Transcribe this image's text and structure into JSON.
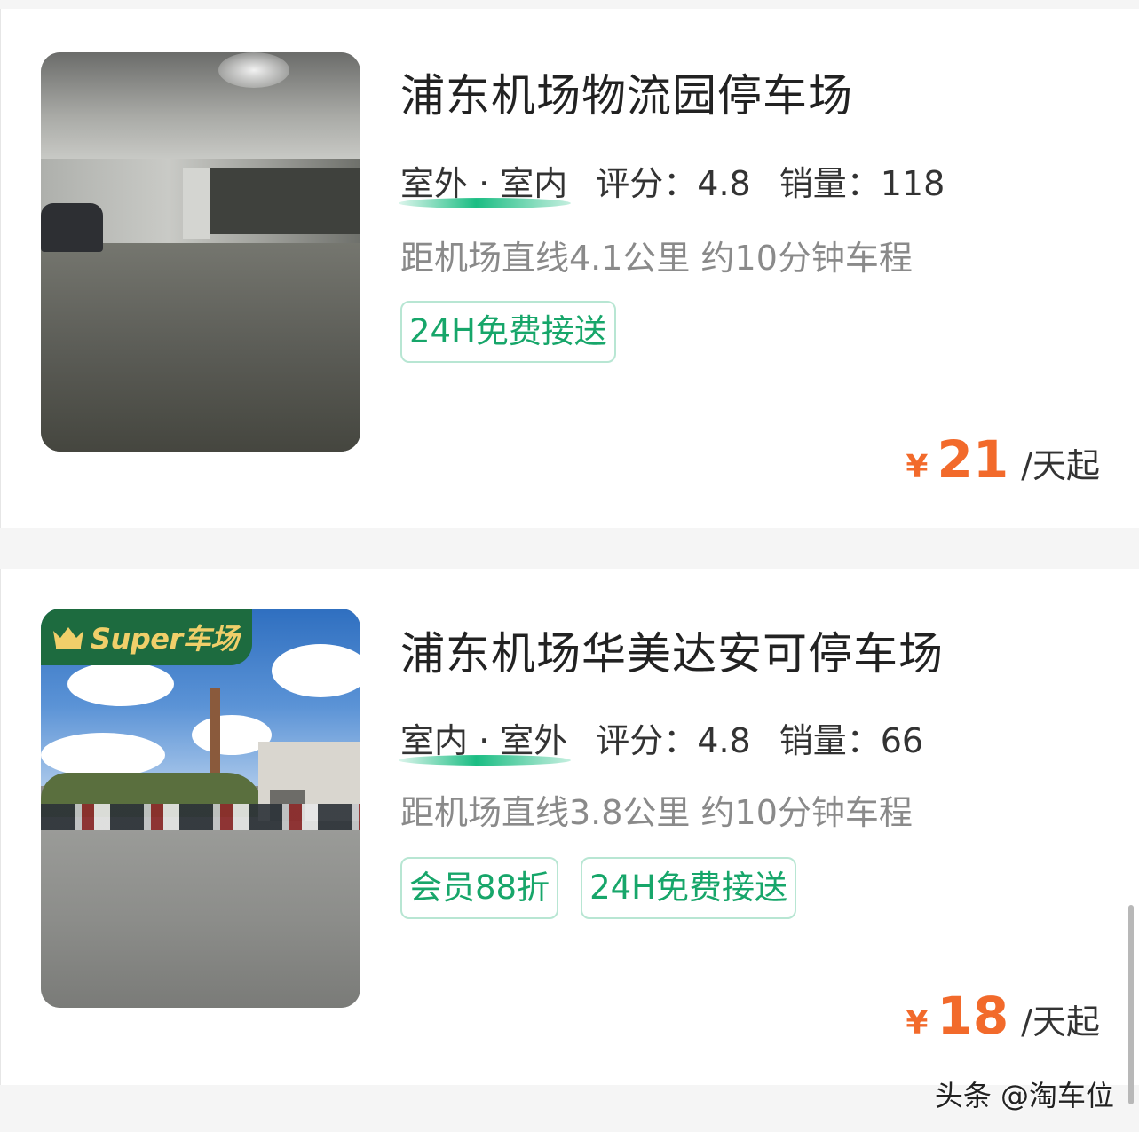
{
  "listings": [
    {
      "title": "浦东机场物流园停车场",
      "type": "室外 · 室内",
      "rating_label": "评分：",
      "rating": "4.8",
      "sales_label": "销量：",
      "sales": "118",
      "distance": "距机场直线4.1公里 约10分钟车程",
      "tags": [
        "24H免费接送"
      ],
      "currency": "¥",
      "price": "21",
      "unit": "/天起",
      "badge": null
    },
    {
      "title": "浦东机场华美达安可停车场",
      "type": "室内 · 室外",
      "rating_label": "评分：",
      "rating": "4.8",
      "sales_label": "销量：",
      "sales": "66",
      "distance": "距机场直线3.8公里 约10分钟车程",
      "tags": [
        "会员88折",
        "24H免费接送"
      ],
      "currency": "¥",
      "price": "18",
      "unit": "/天起",
      "badge": "Super车场"
    }
  ],
  "watermark": "头条 @淘车位",
  "colors": {
    "accent": "#f26a2b",
    "tag_text": "#17a66a",
    "tag_border": "#b8e6d3",
    "underline": "#1bbd83",
    "badge_bg": "#1d6b3f",
    "badge_text": "#f0cf6a"
  },
  "icons": {
    "badge_icon": "crown-icon"
  }
}
